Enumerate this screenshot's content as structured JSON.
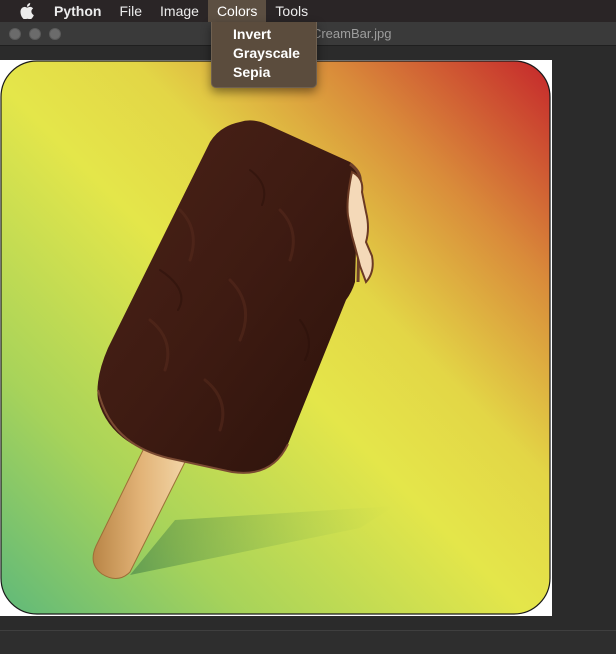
{
  "menubar": {
    "apple_icon": "apple-icon",
    "app_name": "Python",
    "items": [
      "File",
      "Image",
      "Colors",
      "Tools"
    ],
    "active_item": "Colors"
  },
  "window": {
    "title": "Grayscale - IceCreamBar.jpg"
  },
  "colors_menu": {
    "items": [
      "Invert",
      "Grayscale",
      "Sepia"
    ]
  },
  "image": {
    "description_icon": "ice-cream-bar-image"
  },
  "theme": {
    "menu_highlight": "#5c4f42",
    "gradient_yellow": "#e4e64a",
    "gradient_red": "#c9302a",
    "gradient_green": "#66b977",
    "chocolate": "#3f1c12",
    "stick": "#d7a56a"
  }
}
